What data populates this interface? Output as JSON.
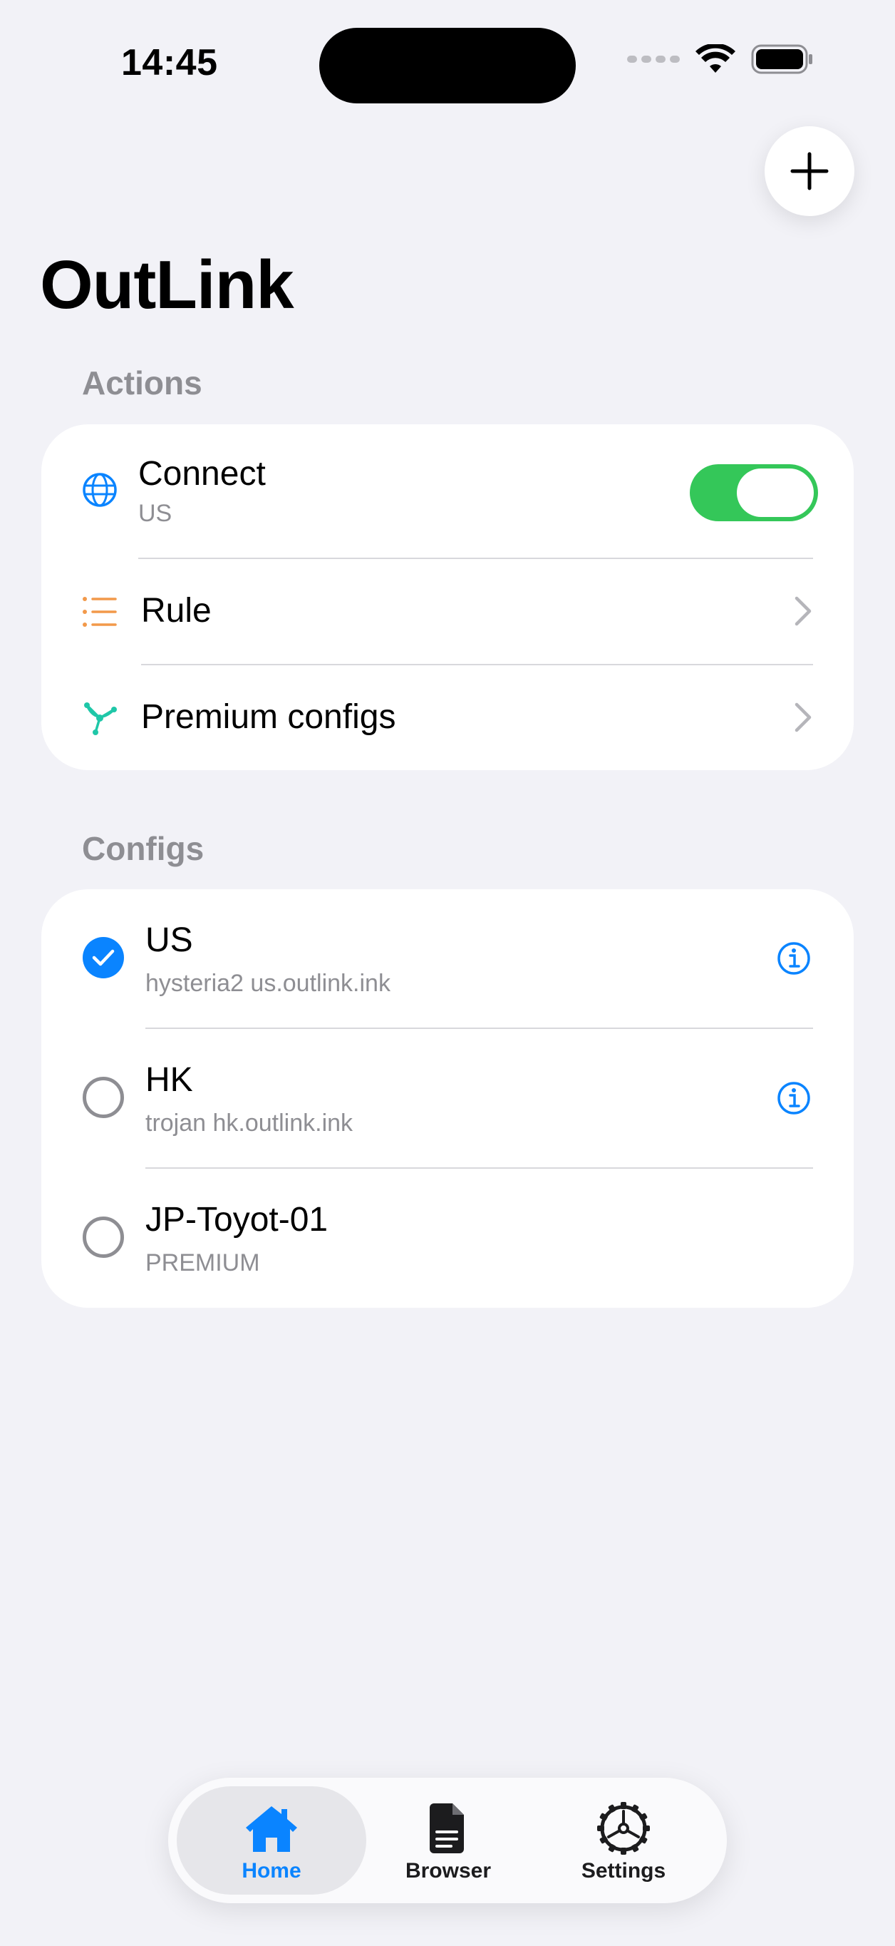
{
  "status_bar": {
    "time": "14:45"
  },
  "header": {
    "title": "OutLink"
  },
  "sections": {
    "actions": {
      "header": "Actions",
      "connect": {
        "label": "Connect",
        "subtitle": "US",
        "enabled": true
      },
      "rule": {
        "label": "Rule"
      },
      "premium": {
        "label": "Premium configs"
      }
    },
    "configs": {
      "header": "Configs",
      "items": [
        {
          "name": "US",
          "detail": "hysteria2 us.outlink.ink",
          "selected": true,
          "has_info": true
        },
        {
          "name": "HK",
          "detail": "trojan hk.outlink.ink",
          "selected": false,
          "has_info": true
        },
        {
          "name": "JP-Toyot-01",
          "detail": "PREMIUM",
          "selected": false,
          "has_info": false
        }
      ]
    }
  },
  "tabbar": {
    "tabs": [
      {
        "label": "Home",
        "icon": "house-icon",
        "active": true
      },
      {
        "label": "Browser",
        "icon": "document-icon",
        "active": false
      },
      {
        "label": "Settings",
        "icon": "gear-icon",
        "active": false
      }
    ]
  },
  "colors": {
    "accent": "#0A84FF",
    "toggle_on": "#34C759",
    "rule_icon": "#F2994A",
    "premium_icon": "#1FC7A8",
    "background": "#F2F2F7"
  }
}
